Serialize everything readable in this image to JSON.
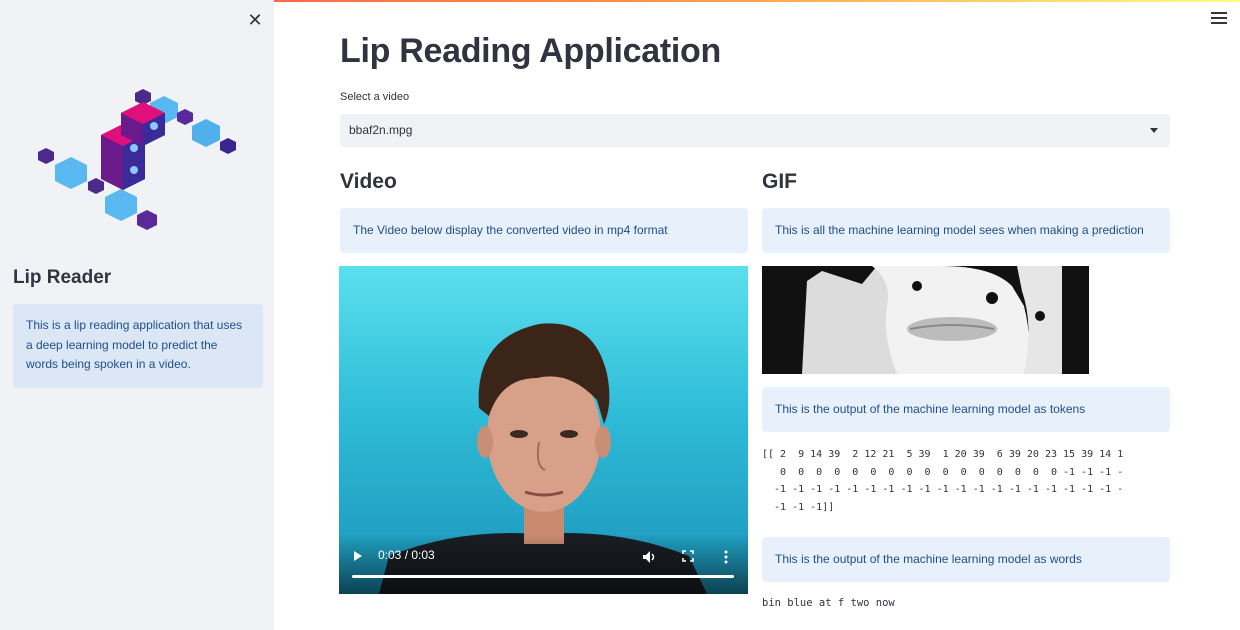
{
  "sidebar": {
    "close_icon": "close-icon",
    "title": "Lip Reader",
    "info": "This is a lip reading application that uses a deep learning model to predict the words being spoken in a video."
  },
  "header": {
    "menu_icon": "hamburger-menu-icon"
  },
  "main": {
    "title": "Lip Reading Application",
    "select": {
      "label": "Select a video",
      "value": "bbaf2n.mpg"
    },
    "video_col": {
      "heading": "Video",
      "info": "The Video below display the converted video in mp4 format",
      "player": {
        "time": "0:03 / 0:03",
        "progress": 1.0
      }
    },
    "gif_col": {
      "heading": "GIF",
      "info": "This is all the machine learning model sees when making a prediction",
      "tokens_info": "This is the output of the machine learning model as tokens",
      "tokens": "[[ 2  9 14 39  2 12 21  5 39  1 20 39  6 39 20 23 15 39 14 1\n   0  0  0  0  0  0  0  0  0  0  0  0  0  0  0  0 -1 -1 -1 -\n  -1 -1 -1 -1 -1 -1 -1 -1 -1 -1 -1 -1 -1 -1 -1 -1 -1 -1 -1 -\n  -1 -1 -1]]",
      "words_info": "This is the output of the machine learning model as words",
      "words": "bin blue at f two now"
    }
  },
  "colors": {
    "accent_gradient": [
      "#ff4b4b",
      "#fffd80"
    ],
    "sidebar_bg": "#f0f2f6",
    "info_bg": "#e8f0fb",
    "info_text": "#1f4e8c"
  }
}
